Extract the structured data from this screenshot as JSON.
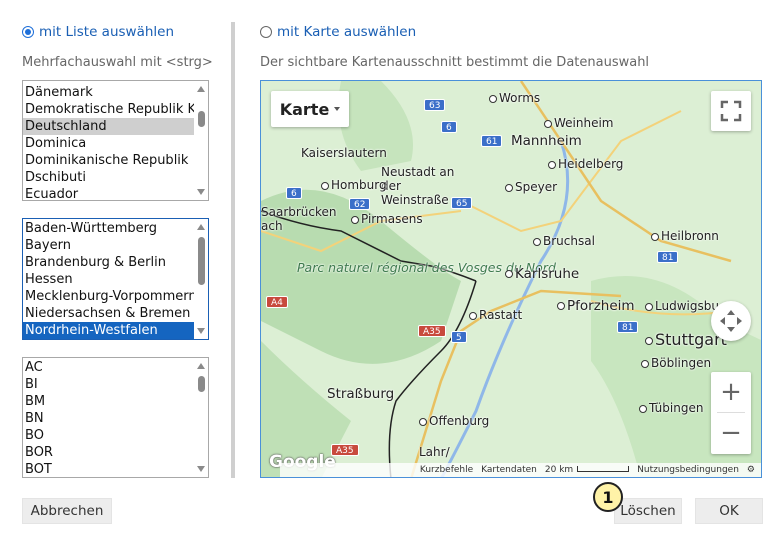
{
  "mode": {
    "list_label": "mit Liste auswählen",
    "map_label": "mit Karte auswählen"
  },
  "list_hint": "Mehrfachauswahl mit <strg>",
  "map_hint": "Der sichtbare Kartenausschnitt bestimmt die Datenauswahl",
  "countries": [
    "Dänemark",
    "Demokratische Republik Kongo",
    "Deutschland",
    "Dominica",
    "Dominikanische Republik",
    "Dschibuti",
    "Ecuador"
  ],
  "states": [
    "Baden-Württemberg",
    "Bayern",
    "Brandenburg & Berlin",
    "Hessen",
    "Mecklenburg-Vorpommern",
    "Niedersachsen & Bremen",
    "Nordrhein-Westfalen"
  ],
  "districts": [
    "AC",
    "BI",
    "BM",
    "BN",
    "BO",
    "BOR",
    "BOT"
  ],
  "map": {
    "type_label": "Karte",
    "cities": {
      "worms": "Worms",
      "weinheim": "Weinheim",
      "kaiserslautern": "Kaiserslautern",
      "mannheim": "Mannheim",
      "neustadt": "Neustadt an der Weinstraße",
      "heidelberg": "Heidelberg",
      "homburg": "Homburg",
      "speyer": "Speyer",
      "saarbruecken": "Saarbrücken",
      "pirmasens": "Pirmasens",
      "bruchsal": "Bruchsal",
      "heilbronn": "Heilbronn",
      "karlsruhe": "Karlsruhe",
      "pforzheim": "Pforzheim",
      "ludwigsburg": "Ludwigsbu",
      "rastatt": "Rastatt",
      "stuttgart": "Stuttgart",
      "boeblingen": "Böblingen",
      "strassburg": "Straßburg",
      "offenburg": "Offenburg",
      "tuebingen": "Tübingen",
      "lahr": "Lahr/",
      "ach": "ach"
    },
    "park": "Parc naturel régional des Vosges du Nord",
    "shields": {
      "a63": "63",
      "a6a": "6",
      "a61": "61",
      "a6b": "6",
      "a62": "62",
      "a65": "65",
      "a5": "5",
      "a81a": "81",
      "a81b": "81",
      "a4": "A4",
      "a35a": "A35",
      "a35b": "A35"
    },
    "google_logo": "Google",
    "attribution": {
      "shortcuts": "Kurzbefehle",
      "mapdata": "Kartendaten",
      "scale": "20 km",
      "terms": "Nutzungsbedingungen"
    },
    "zoom_in": "+",
    "zoom_out": "−"
  },
  "buttons": {
    "cancel": "Abbrechen",
    "delete": "Löschen",
    "ok": "OK"
  },
  "badge_number": "1",
  "colors": {
    "accent": "#1a5fb4",
    "selection_blue": "#1565c0",
    "selection_gray": "#cfcfcf",
    "badge": "#fff3a8"
  }
}
